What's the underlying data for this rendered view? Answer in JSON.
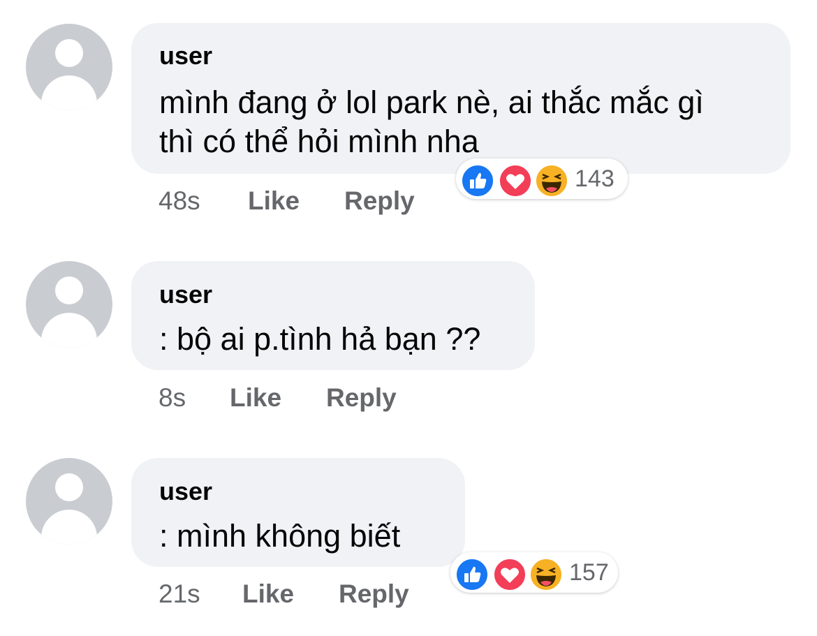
{
  "colors": {
    "bubble": "#f0f2f5",
    "meta_text": "#65676b",
    "like": "#1877f2",
    "love": "#f33e58",
    "haha": "#f7b125"
  },
  "comments": [
    {
      "author": "user",
      "text_lines": [
        "mình đang ở lol park nè, ai thắc mắc gì",
        "thì có thể hỏi mình nha"
      ],
      "time": "48s",
      "like_label": "Like",
      "reply_label": "Reply",
      "reactions": {
        "icons": [
          "like-icon",
          "love-icon",
          "haha-icon"
        ],
        "count": "143"
      }
    },
    {
      "author": "user",
      "text_lines": [
        ": bộ ai p.tình hả bạn ??"
      ],
      "time": "8s",
      "like_label": "Like",
      "reply_label": "Reply"
    },
    {
      "author": "user",
      "text_lines": [
        ": mình không biết"
      ],
      "time": "21s",
      "like_label": "Like",
      "reply_label": "Reply",
      "reactions": {
        "icons": [
          "like-icon",
          "love-icon",
          "haha-icon"
        ],
        "count": "157"
      }
    }
  ]
}
